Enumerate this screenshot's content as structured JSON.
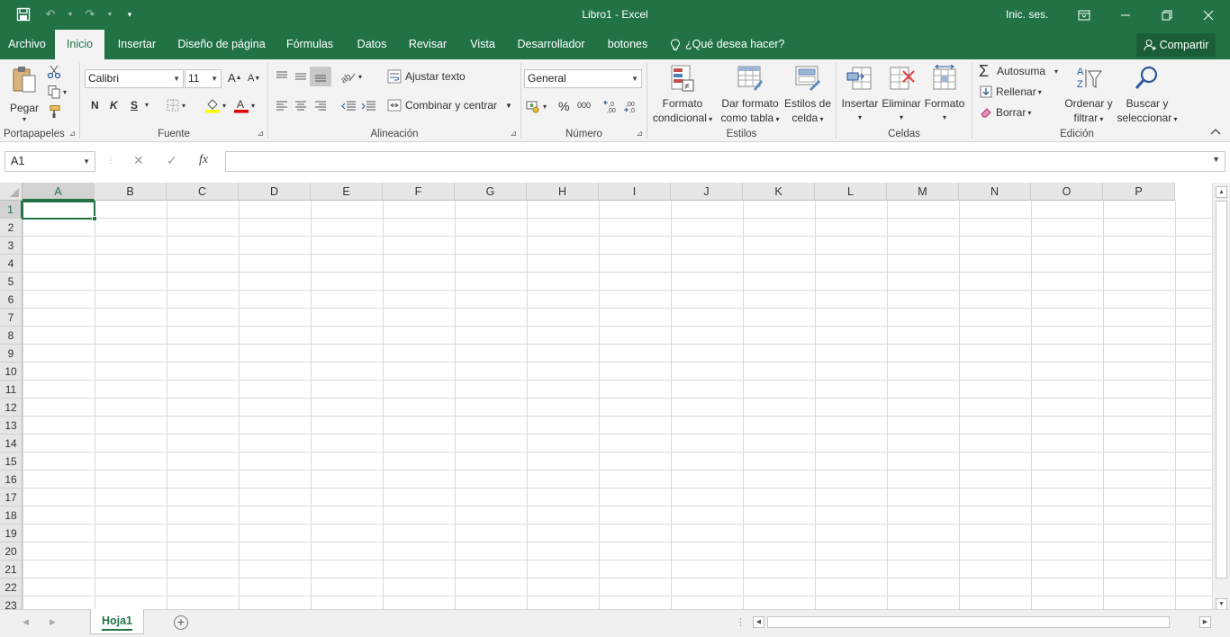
{
  "window": {
    "title": "Libro1  -  Excel",
    "sign_in": "Inic. ses.",
    "qat": {
      "save_icon": "save-icon",
      "undo_icon": "undo-icon",
      "redo_icon": "redo-icon",
      "customize_icon": "customize-qat-icon"
    },
    "controls": {
      "restore_ribbon": "ribbon-display-options-icon",
      "minimize": "minimize-icon",
      "maximize": "restore-icon",
      "close": "close-icon"
    }
  },
  "tabs": [
    {
      "label": "Archivo"
    },
    {
      "label": "Inicio",
      "active": true
    },
    {
      "label": "Insertar"
    },
    {
      "label": "Diseño de página"
    },
    {
      "label": "Fórmulas"
    },
    {
      "label": "Datos"
    },
    {
      "label": "Revisar"
    },
    {
      "label": "Vista"
    },
    {
      "label": "Desarrollador"
    },
    {
      "label": "botones"
    }
  ],
  "tell_me": "¿Qué desea hacer?",
  "share_label": "Compartir",
  "ribbon": {
    "clipboard": {
      "label": "Portapapeles",
      "paste": "Pegar"
    },
    "font": {
      "label": "Fuente",
      "name": "Calibri",
      "size": "11",
      "bold": "N",
      "italic": "K",
      "underline": "S"
    },
    "alignment": {
      "label": "Alineación",
      "wrap": "Ajustar texto",
      "merge": "Combinar y centrar"
    },
    "number": {
      "label": "Número",
      "format": "General",
      "percent": "%",
      "thousands": "000",
      "inc_dec": ",0",
      "dec_dec": ",00"
    },
    "styles": {
      "label": "Estilos",
      "conditional_1": "Formato",
      "conditional_2": "condicional",
      "table_1": "Dar formato",
      "table_2": "como tabla",
      "cell_1": "Estilos de",
      "cell_2": "celda"
    },
    "cells": {
      "label": "Celdas",
      "insert": "Insertar",
      "delete": "Eliminar",
      "format": "Formato"
    },
    "editing": {
      "label": "Edición",
      "autosum": "Autosuma",
      "fill": "Rellenar",
      "clear": "Borrar",
      "sort_1": "Ordenar y",
      "sort_2": "filtrar",
      "find_1": "Buscar y",
      "find_2": "seleccionar"
    }
  },
  "formula_bar": {
    "name_box": "A1",
    "fx": "fx",
    "value": ""
  },
  "columns": [
    "A",
    "B",
    "C",
    "D",
    "E",
    "F",
    "G",
    "H",
    "I",
    "J",
    "K",
    "L",
    "M",
    "N",
    "O",
    "P"
  ],
  "rows": [
    "1",
    "2",
    "3",
    "4",
    "5",
    "6",
    "7",
    "8",
    "9",
    "10",
    "11",
    "12",
    "13",
    "14",
    "15",
    "16",
    "17",
    "18",
    "19",
    "20",
    "21",
    "22",
    "23"
  ],
  "selected_cell": "A1",
  "sheets": [
    {
      "name": "Hoja1",
      "active": true
    }
  ],
  "colors": {
    "accent": "#217346"
  }
}
